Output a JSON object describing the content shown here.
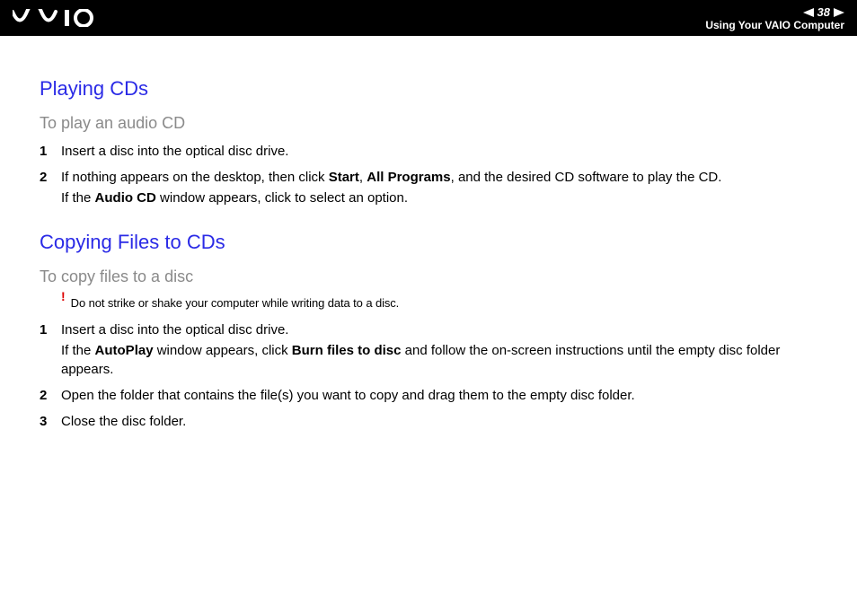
{
  "header": {
    "page_number": "38",
    "section_title": "Using Your VAIO Computer"
  },
  "sections": {
    "playing": {
      "heading": "Playing CDs",
      "subheading": "To play an audio CD",
      "steps": [
        {
          "num": "1",
          "text1": "Insert a disc into the optical disc drive."
        },
        {
          "num": "2",
          "text1_pre": "If nothing appears on the desktop, then click ",
          "b1": "Start",
          "text1_mid1": ", ",
          "b2": "All Programs",
          "text1_post": ", and the desired CD software to play the CD.",
          "text2_pre": "If the ",
          "b3": "Audio CD",
          "text2_post": " window appears, click to select an option."
        }
      ]
    },
    "copying": {
      "heading": "Copying Files to CDs",
      "subheading": "To copy files to a disc",
      "warning": "Do not strike or shake your computer while writing data to a disc.",
      "steps": [
        {
          "num": "1",
          "text1": "Insert a disc into the optical disc drive.",
          "text2_pre": "If the ",
          "b1": "AutoPlay",
          "text2_mid": " window appears, click ",
          "b2": "Burn files to disc",
          "text2_post": " and follow the on-screen instructions until the empty disc folder appears."
        },
        {
          "num": "2",
          "text1": "Open the folder that contains the file(s) you want to copy and drag them to the empty disc folder."
        },
        {
          "num": "3",
          "text1": "Close the disc folder."
        }
      ]
    }
  }
}
